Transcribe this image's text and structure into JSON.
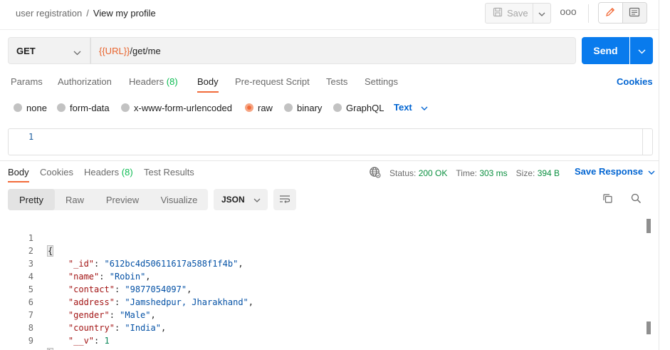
{
  "breadcrumb": {
    "parent": "user registration",
    "separator": "/",
    "current": "View my profile"
  },
  "toolbar": {
    "save_label": "Save",
    "more_label": "ooo"
  },
  "request": {
    "method": "GET",
    "url_variable": "{{URL}}",
    "url_path": "/get/me",
    "send_label": "Send"
  },
  "request_tabs": [
    {
      "label": "Params"
    },
    {
      "label": "Authorization"
    },
    {
      "label": "Headers",
      "count": "(8)"
    },
    {
      "label": "Body"
    },
    {
      "label": "Pre-request Script"
    },
    {
      "label": "Tests"
    },
    {
      "label": "Settings"
    }
  ],
  "cookies_label": "Cookies",
  "body_types": [
    {
      "label": "none",
      "selected": false
    },
    {
      "label": "form-data",
      "selected": false
    },
    {
      "label": "x-www-form-urlencoded",
      "selected": false
    },
    {
      "label": "raw",
      "selected": true
    },
    {
      "label": "binary",
      "selected": false
    },
    {
      "label": "GraphQL",
      "selected": false
    }
  ],
  "raw_format": "Text",
  "request_editor": {
    "line_number": "1"
  },
  "response_tabs": [
    {
      "label": "Body"
    },
    {
      "label": "Cookies"
    },
    {
      "label": "Headers",
      "count": "(8)"
    },
    {
      "label": "Test Results"
    }
  ],
  "response_status": {
    "status_label": "Status:",
    "status_value": "200 OK",
    "time_label": "Time:",
    "time_value": "303 ms",
    "size_label": "Size:",
    "size_value": "394 B"
  },
  "save_response_label": "Save Response",
  "format_tabs": [
    {
      "label": "Pretty"
    },
    {
      "label": "Raw"
    },
    {
      "label": "Preview"
    },
    {
      "label": "Visualize"
    }
  ],
  "response_format": "JSON",
  "response_lines": [
    {
      "num": "1",
      "key": "",
      "value": "",
      "open": "{",
      "close": ""
    },
    {
      "num": "2",
      "key": "\"_id\"",
      "value": "\"612bc4d50611617a588f1f4b\"",
      "type": "s"
    },
    {
      "num": "3",
      "key": "\"name\"",
      "value": "\"Robin\"",
      "type": "s"
    },
    {
      "num": "4",
      "key": "\"contact\"",
      "value": "\"9877054097\"",
      "type": "s"
    },
    {
      "num": "5",
      "key": "\"address\"",
      "value": "\"Jamshedpur, Jharakhand\"",
      "type": "s"
    },
    {
      "num": "6",
      "key": "\"gender\"",
      "value": "\"Male\"",
      "type": "s"
    },
    {
      "num": "7",
      "key": "\"country\"",
      "value": "\"India\"",
      "type": "s"
    },
    {
      "num": "8",
      "key": "\"__v\"",
      "value": "1",
      "type": "n"
    },
    {
      "num": "9",
      "key": "",
      "value": "",
      "open": "",
      "close": "}"
    }
  ],
  "colors": {
    "accent_send": "#097bed",
    "active_tab": "#f26b3a",
    "status_ok": "#0a8f3f",
    "link": "#0265d2"
  }
}
